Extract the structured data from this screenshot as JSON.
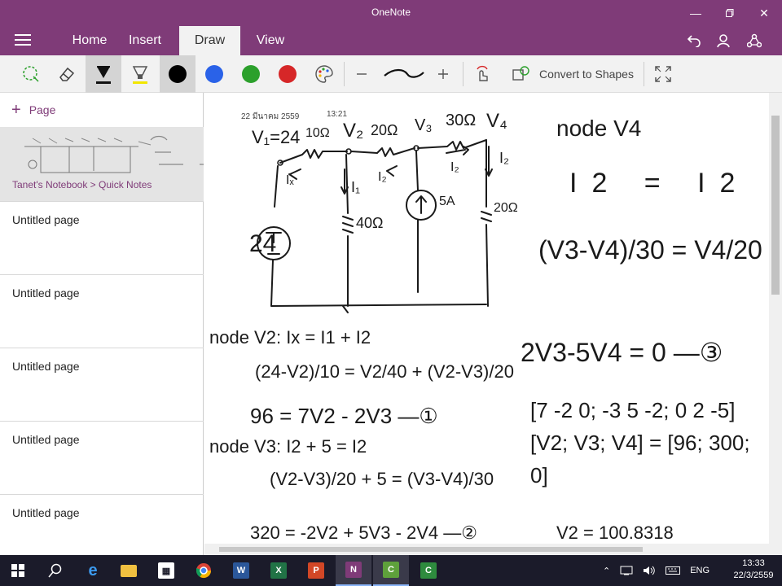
{
  "app": {
    "title": "OneNote"
  },
  "tabs": [
    {
      "label": "Home"
    },
    {
      "label": "Insert"
    },
    {
      "label": "Draw"
    },
    {
      "label": "View"
    }
  ],
  "toolbar": {
    "convert_label": "Convert to Shapes",
    "pen_colors": [
      "#000000",
      "#2a62e8",
      "#2ca02c",
      "#d62728"
    ]
  },
  "sidebar": {
    "add_page_label": "Page",
    "breadcrumb": "Tanet's Notebook > Quick Notes",
    "pages": [
      {
        "label": "Untitled page"
      },
      {
        "label": "Untitled page"
      },
      {
        "label": "Untitled page"
      },
      {
        "label": "Untitled page"
      },
      {
        "label": "Untitled page"
      }
    ]
  },
  "note": {
    "date": "22 มีนาคม 2559",
    "time": "13:21",
    "handwriting": {
      "node_v4": "node V4",
      "eq1": "I2 = I2",
      "eq2": "(V3-V4)/30 = V4/20",
      "eq3": "2V3-5V4 = 0 —③",
      "matrix": "[7 -2 0; -3 5 -2; 0 2 -5][V2; V3; V4] = [96; 300; 0]",
      "node_v2": "node V2: Ix = I1 + I2",
      "eq4": "(24-V2)/10 = V2/40 + (V2-V3)/20",
      "eq5": "96 = 7V2 - 2V3 —①",
      "node_v3": "node V3: I2 + 5 = I2",
      "eq6": "(V2-V3)/20 + 5 = (V3-V4)/30",
      "eq7": "320 = -2V2 + 5V3 - 2V4 —②",
      "eq8": "V2 = 100.8318"
    }
  },
  "taskbar": {
    "lang": "ENG",
    "clock_time": "13:33",
    "clock_date": "22/3/2559"
  }
}
